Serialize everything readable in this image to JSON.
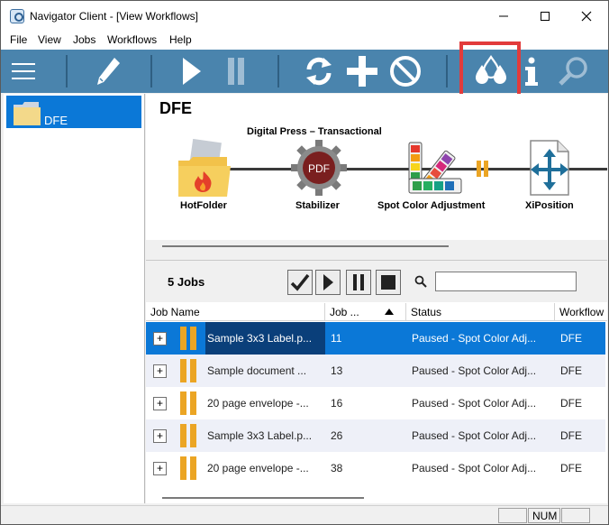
{
  "window": {
    "title": "Navigator Client - [View Workflows]",
    "buttons": {
      "minimize": "minimize-icon",
      "maximize": "maximize-icon",
      "close": "close-icon"
    }
  },
  "menu": [
    "File",
    "View",
    "Jobs",
    "Workflows",
    "Help"
  ],
  "toolbar": {
    "icons": [
      "menu-icon",
      "pencil-icon",
      "play-icon",
      "pause-icon",
      "refresh-icon",
      "plus-icon",
      "cancel-icon",
      "ink-drops-icon",
      "info-icon",
      "search-icon"
    ],
    "background": "#4a84ad",
    "highlight_color": "#e23b3b"
  },
  "tree": {
    "selected": "DFE"
  },
  "workflow": {
    "title": "DFE",
    "subtitle": "Digital Press – Transactional",
    "nodes": [
      {
        "label": "HotFolder",
        "icon": "hotfolder-icon"
      },
      {
        "label": "Stabilizer",
        "icon": "pdf-gear-icon",
        "badge": "PDF"
      },
      {
        "label": "Spot Color Adjustment",
        "icon": "color-swatch-icon"
      },
      {
        "label": "XiPosition",
        "icon": "arrows-document-icon"
      }
    ]
  },
  "jobs": {
    "count_label": "5 Jobs",
    "action_icons": [
      "checkmark-icon",
      "play-icon",
      "pause-icon",
      "stop-icon"
    ],
    "search": {
      "value": "",
      "placeholder": ""
    },
    "columns": [
      "Job Name",
      "Job ...",
      "Status",
      "Workflow"
    ],
    "rows": [
      {
        "name": "Sample 3x3 Label.p...",
        "job": "11",
        "status": "Paused - Spot Color Adj...",
        "workflow": "DFE"
      },
      {
        "name": "Sample document ...",
        "job": "13",
        "status": "Paused - Spot Color Adj...",
        "workflow": "DFE"
      },
      {
        "name": "20 page envelope -...",
        "job": "16",
        "status": "Paused - Spot Color Adj...",
        "workflow": "DFE"
      },
      {
        "name": "Sample 3x3 Label.p...",
        "job": "26",
        "status": "Paused - Spot Color Adj...",
        "workflow": "DFE"
      },
      {
        "name": "20 page envelope -...",
        "job": "38",
        "status": "Paused - Spot Color Adj...",
        "workflow": "DFE"
      }
    ],
    "selected_row": 0
  },
  "statusbar": {
    "num": "NUM"
  },
  "colors": {
    "selection": "#0b78d7",
    "pause": "#eba524"
  }
}
